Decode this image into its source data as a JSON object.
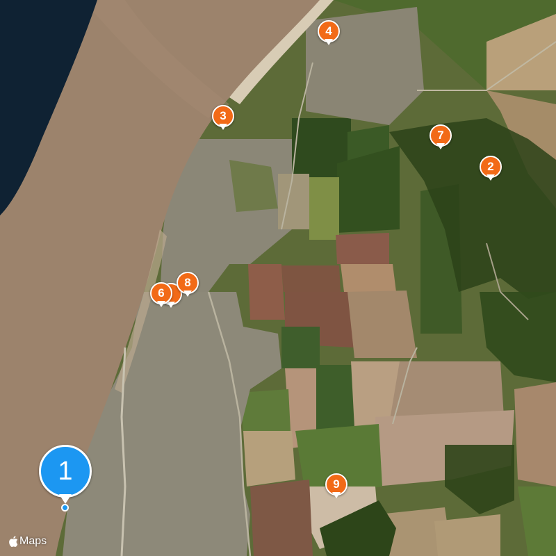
{
  "map": {
    "type": "satellite",
    "attribution": "Maps",
    "colors": {
      "sea": "#0f2233",
      "beach": "#9c836c",
      "fields": "#4e5f2e",
      "marker": "#f26a17",
      "selected_marker": "#1c97f2"
    }
  },
  "markers": [
    {
      "label": "1",
      "selected": true
    },
    {
      "label": "2"
    },
    {
      "label": "3"
    },
    {
      "label": "4"
    },
    {
      "label": "6"
    },
    {
      "label": "7"
    },
    {
      "label": "8"
    },
    {
      "label": "9"
    }
  ]
}
